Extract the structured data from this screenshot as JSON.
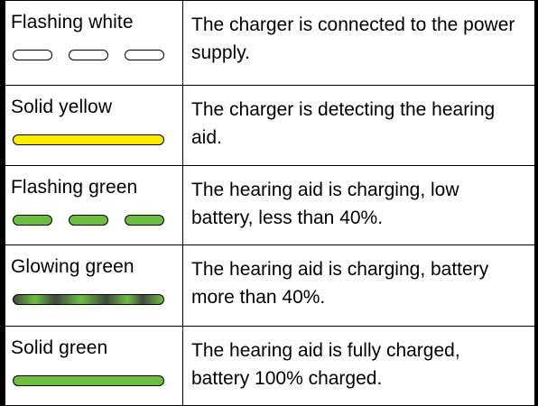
{
  "colors": {
    "white": "#ffffff",
    "yellow": "#ffeb00",
    "green": "#6cbe3f",
    "glow_dark": "#3f4a3c"
  },
  "rows": [
    {
      "label": "Flashing white",
      "description": "The charger is connected to the power supply.",
      "indicator": "flashing",
      "color_key": "white"
    },
    {
      "label": "Solid yellow",
      "description": "The charger is detecting the hearing aid.",
      "indicator": "solid",
      "color_key": "yellow"
    },
    {
      "label": "Flashing green",
      "description": "The hearing aid is charging, low battery, less than 40%.",
      "indicator": "flashing",
      "color_key": "green"
    },
    {
      "label": "Glowing green",
      "description": "The hearing aid is charging, battery more than 40%.",
      "indicator": "glowing",
      "color_key": "green"
    },
    {
      "label": "Solid green",
      "description": "The hearing aid is fully charged, battery 100% charged.",
      "indicator": "solid",
      "color_key": "green"
    }
  ]
}
